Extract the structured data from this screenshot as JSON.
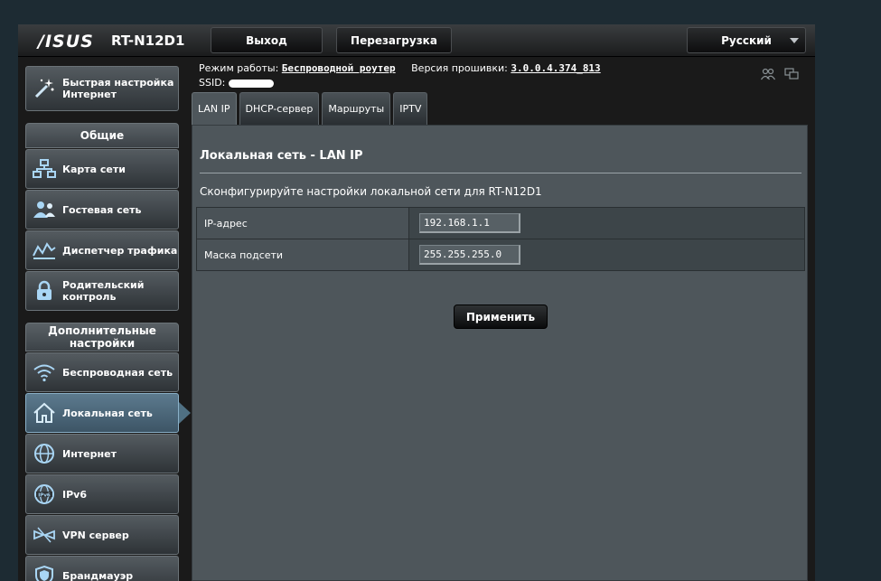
{
  "header": {
    "brand": "/ISUS",
    "model": "RT-N12D1",
    "logout_label": "Выход",
    "reboot_label": "Перезагрузка",
    "language": "Русский"
  },
  "info": {
    "mode_label": "Режим работы:",
    "mode_value": "Беспроводной роутер",
    "firmware_label": "Версия прошивки:",
    "firmware_value": "3.0.0.4.374_813",
    "ssid_label": "SSID:"
  },
  "sidebar": {
    "quick_setup": "Быстрая настройка Интернет",
    "general_header": "Общие",
    "general_items": [
      {
        "label": "Карта сети",
        "icon": "network-map-icon"
      },
      {
        "label": "Гостевая сеть",
        "icon": "guest-network-icon"
      },
      {
        "label": "Диспетчер трафика",
        "icon": "traffic-manager-icon"
      },
      {
        "label": "Родительский контроль",
        "icon": "parental-control-icon"
      }
    ],
    "advanced_header": "Дополнительные настройки",
    "advanced_items": [
      {
        "label": "Беспроводная сеть",
        "icon": "wireless-icon"
      },
      {
        "label": "Локальная сеть",
        "icon": "home-icon",
        "active": true
      },
      {
        "label": "Интернет",
        "icon": "globe-icon"
      },
      {
        "label": "IPv6",
        "icon": "ipv6-icon"
      },
      {
        "label": "VPN сервер",
        "icon": "vpn-icon"
      },
      {
        "label": "Брандмауэр",
        "icon": "firewall-icon"
      }
    ]
  },
  "tabs": [
    {
      "label": "LAN IP",
      "active": true
    },
    {
      "label": "DHCP-сервер"
    },
    {
      "label": "Маршруты"
    },
    {
      "label": "IPTV"
    }
  ],
  "panel": {
    "title": "Локальная сеть - LAN IP",
    "description": "Сконфигурируйте настройки локальной сети для RT-N12D1",
    "fields": [
      {
        "label": "IP-адрес",
        "value": "192.168.1.1"
      },
      {
        "label": "Маска подсети",
        "value": "255.255.255.0"
      }
    ],
    "apply_label": "Применить"
  },
  "colors": {
    "background": "#1d2b33",
    "panel": "#4e565b",
    "active_item": "#4f7083"
  }
}
